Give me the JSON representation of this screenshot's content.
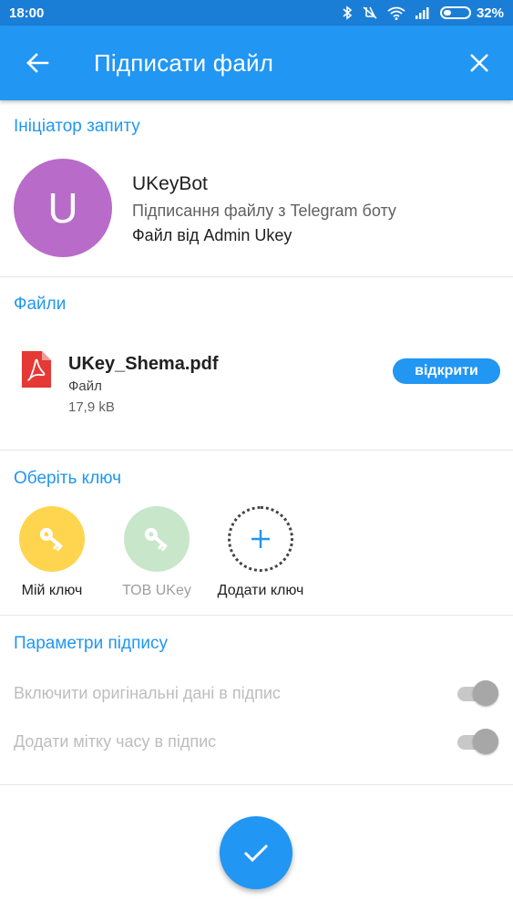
{
  "status_bar": {
    "time": "18:00",
    "battery": "32%",
    "battery_level": 0.32
  },
  "app_bar": {
    "title": "Підписати файл",
    "back_icon": "arrow-back-icon",
    "close_icon": "close-icon"
  },
  "initiator": {
    "section_title": "Ініціатор запиту",
    "avatar_letter": "U",
    "avatar_color": "#b86bc9",
    "name": "UKeyBot",
    "description": "Підписання файлу з Telegram боту",
    "file_from": "Файл від Admin Ukey"
  },
  "files": {
    "section_title": "Файли",
    "items": [
      {
        "name": "UKey_Shema.pdf",
        "type": "Файл",
        "size": "17,9 kB",
        "open_label": "відкрити",
        "icon": "pdf-file-icon"
      }
    ]
  },
  "keys": {
    "section_title": "Оберіть ключ",
    "items": [
      {
        "label": "Мій ключ",
        "color": "#ffd54f",
        "icon": "key-icon"
      },
      {
        "label": "ТОВ UKey",
        "color": "#c8e6c9",
        "icon": "key-icon"
      },
      {
        "label": "Додати ключ",
        "icon": "plus-icon"
      }
    ]
  },
  "params": {
    "section_title": "Параметри підпису",
    "items": [
      {
        "label": "Включити оригінальні дані в підпис",
        "enabled": false
      },
      {
        "label": "Додати мітку часу в підпис",
        "enabled": false
      }
    ]
  },
  "fab": {
    "icon": "checkmark-icon"
  },
  "colors": {
    "primary": "#2196f3",
    "status_bar": "#1b7ed6"
  }
}
